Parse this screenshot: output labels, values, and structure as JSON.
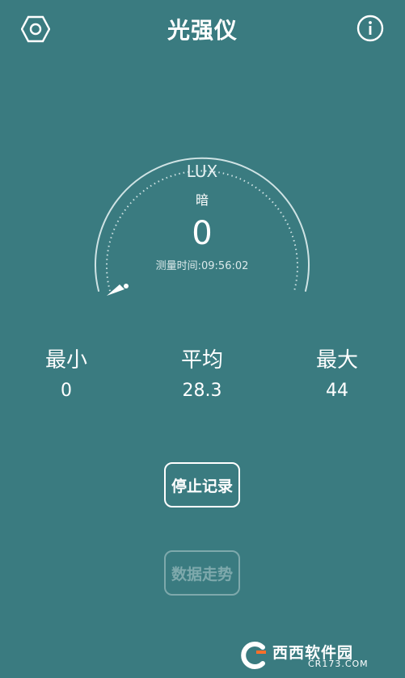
{
  "header": {
    "title": "光强仪",
    "settings_icon": "hexagon-settings-icon",
    "info_icon": "info-icon"
  },
  "gauge": {
    "unit": "LUX",
    "level_text": "暗",
    "reading": "0",
    "time_label": "测量时间:",
    "time_value": "09:56:02"
  },
  "stats": {
    "min": {
      "label": "最小",
      "value": "0"
    },
    "avg": {
      "label": "平均",
      "value": "28.3"
    },
    "max": {
      "label": "最大",
      "value": "44"
    }
  },
  "buttons": {
    "stop_record": "停止记录",
    "data_trend": "数据走势"
  },
  "watermark": {
    "logo_text": "西西软件园",
    "url": "CR173.COM"
  },
  "colors": {
    "background": "#3a7b80",
    "foreground": "#ffffff",
    "watermark_accent": "#ff6f2a"
  }
}
